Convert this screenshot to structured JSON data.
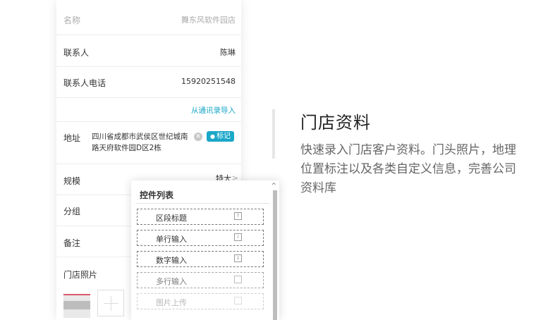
{
  "form": {
    "name": {
      "label": "名称",
      "value": "舞东风软件园店"
    },
    "contact": {
      "label": "联系人",
      "value": "陈琳"
    },
    "phone": {
      "label": "联系人电话",
      "value": "15920251548"
    },
    "import_link": "从通讯录导入",
    "address": {
      "label": "地址",
      "value": "四川省成都市武侯区世纪城南路天府软件园D区2栋",
      "mark_label": "标记"
    },
    "scale": {
      "label": "规模",
      "value": "特大"
    },
    "group": {
      "label": "分组"
    },
    "note": {
      "label": "备注"
    },
    "photo": {
      "label": "门店照片"
    }
  },
  "control_panel": {
    "title": "控件列表",
    "items": [
      {
        "label": "区段标题",
        "icon": "title-icon"
      },
      {
        "label": "单行输入",
        "icon": "single-line-icon"
      },
      {
        "label": "数字输入",
        "icon": "number-icon"
      },
      {
        "label": "多行输入",
        "icon": "multi-line-icon"
      },
      {
        "label": "图片上传",
        "icon": "image-upload-icon"
      }
    ]
  },
  "feature": {
    "title": "门店资料",
    "description": "快速录入门店客户资料。门头照片，地理位置标注以及各类自定义信息，完善公司资料库"
  },
  "colors": {
    "accent": "#1aa7c8"
  }
}
